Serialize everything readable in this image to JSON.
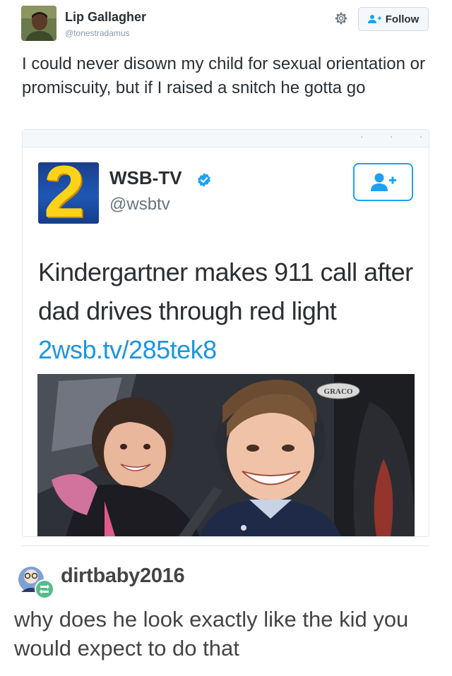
{
  "tweet": {
    "author_name": "Lip Gallagher",
    "author_handle": "@tonestradamus",
    "follow_label": "Follow",
    "text": "I could never disown my child for sexual orientation or promiscuity, but if I raised a snitch he gotta go"
  },
  "quoted": {
    "account_name": "WSB-TV",
    "account_handle": "@wsbtv",
    "logo_text": "2",
    "text": "Kindergartner makes 911 call after dad drives through red light ",
    "link": "2wsb.tv/285tek8",
    "photo_brand": "GRACO",
    "verified": true
  },
  "reblog": {
    "username": "dirtbaby2016",
    "comment": "why does he look exactly like the kid you would expect to do that"
  },
  "colors": {
    "link": "#1b95e0",
    "twitter_blue": "#1da1f2",
    "reblog_green": "#56bc8a"
  },
  "icons": [
    "gear-icon",
    "follow-user-icon",
    "verified-badge-icon",
    "reblog-icon"
  ]
}
